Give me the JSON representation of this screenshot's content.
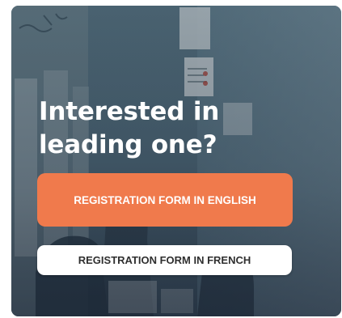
{
  "card": {
    "headline_line1": "Interested in",
    "headline_line2": "leading one?"
  },
  "buttons": {
    "english_label": "REGISTRATION FORM IN ENGLISH",
    "french_label": "REGISTRATION FORM IN FRENCH"
  },
  "colors": {
    "english_button": "#f07a4c",
    "french_button": "#ffffff",
    "headline_text": "#ffffff"
  }
}
